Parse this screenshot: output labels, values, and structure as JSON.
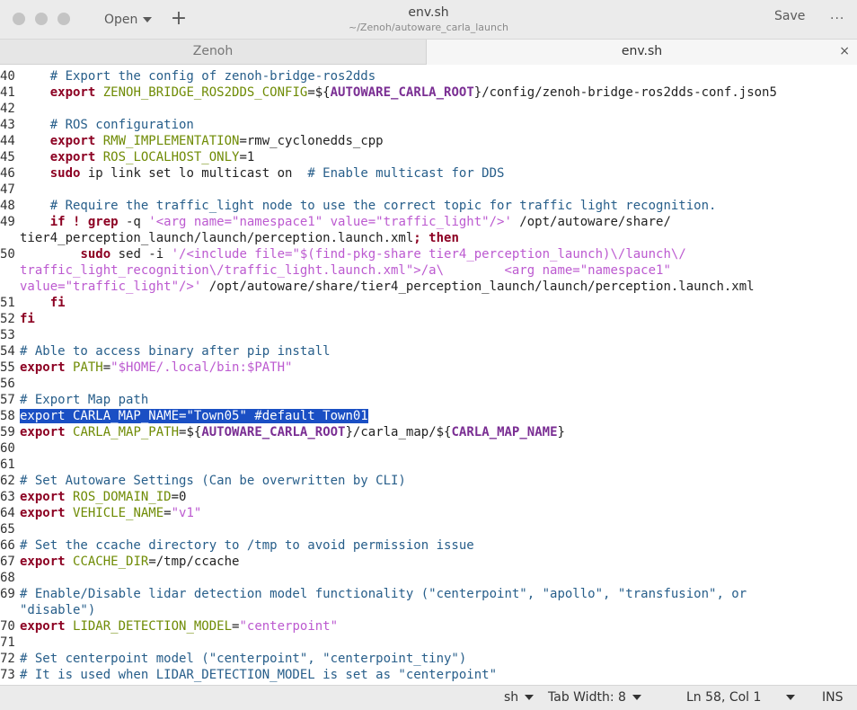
{
  "window": {
    "title": "env.sh",
    "subtitle": "~/Zenoh/autoware_carla_launch",
    "open_label": "Open",
    "new_tab_icon": "plus-icon",
    "save_label": "Save",
    "menu_icon": "ellipsis-icon"
  },
  "tabs": [
    {
      "label": "Zenoh",
      "active": false
    },
    {
      "label": "env.sh",
      "active": true,
      "close": "×"
    }
  ],
  "editor": {
    "current_line": "58",
    "lines": [
      {
        "n": "40",
        "segs": [
          [
            "w",
            "    "
          ],
          [
            "c",
            "# Export the config of zenoh-bridge-ros2dds"
          ]
        ]
      },
      {
        "n": "41",
        "segs": [
          [
            "w",
            "    "
          ],
          [
            "k",
            "export"
          ],
          [
            "w",
            " "
          ],
          [
            "v",
            "ZENOH_BRIDGE_ROS2DDS_CONFIG"
          ],
          [
            "w",
            "=${"
          ],
          [
            "hv",
            "AUTOWARE_CARLA_ROOT"
          ],
          [
            "w",
            "}/config/zenoh-bridge-ros2dds-conf.json5"
          ]
        ]
      },
      {
        "n": "42",
        "segs": []
      },
      {
        "n": "43",
        "segs": [
          [
            "w",
            "    "
          ],
          [
            "c",
            "# ROS configuration"
          ]
        ]
      },
      {
        "n": "44",
        "segs": [
          [
            "w",
            "    "
          ],
          [
            "k",
            "export"
          ],
          [
            "w",
            " "
          ],
          [
            "v",
            "RMW_IMPLEMENTATION"
          ],
          [
            "w",
            "=rmw_cyclonedds_cpp"
          ]
        ]
      },
      {
        "n": "45",
        "segs": [
          [
            "w",
            "    "
          ],
          [
            "k",
            "export"
          ],
          [
            "w",
            " "
          ],
          [
            "v",
            "ROS_LOCALHOST_ONLY"
          ],
          [
            "w",
            "=1"
          ]
        ]
      },
      {
        "n": "46",
        "segs": [
          [
            "w",
            "    "
          ],
          [
            "k",
            "sudo"
          ],
          [
            "w",
            " ip link set lo multicast on  "
          ],
          [
            "c",
            "# Enable multicast for DDS"
          ]
        ]
      },
      {
        "n": "47",
        "segs": []
      },
      {
        "n": "48",
        "segs": [
          [
            "w",
            "    "
          ],
          [
            "c",
            "# Require the traffic_light node to use the correct topic for traffic light recognition."
          ]
        ]
      },
      {
        "n": "49",
        "segs": [
          [
            "w",
            "    "
          ],
          [
            "k",
            "if ! grep"
          ],
          [
            "w",
            " -q "
          ],
          [
            "s",
            "'<arg name=\"namespace1\" value=\"traffic_light\"/>'"
          ],
          [
            "w",
            " /opt/autoware/share/"
          ]
        ]
      },
      {
        "n": "",
        "segs": [
          [
            "w",
            "tier4_perception_launch/launch/perception.launch.xml"
          ],
          [
            "k",
            "; then"
          ]
        ]
      },
      {
        "n": "50",
        "segs": [
          [
            "w",
            "        "
          ],
          [
            "k",
            "sudo"
          ],
          [
            "w",
            " sed -i "
          ],
          [
            "s",
            "'/<include file=\"$(find-pkg-share tier4_perception_launch)\\/launch\\/"
          ]
        ]
      },
      {
        "n": "",
        "segs": [
          [
            "s",
            "traffic_light_recognition\\/traffic_light.launch.xml\">/a\\        <arg name=\"namespace1\""
          ]
        ]
      },
      {
        "n": "",
        "segs": [
          [
            "s",
            "value=\"traffic_light\"/>'"
          ],
          [
            "w",
            " /opt/autoware/share/tier4_perception_launch/launch/perception.launch.xml"
          ]
        ]
      },
      {
        "n": "51",
        "segs": [
          [
            "w",
            "    "
          ],
          [
            "k",
            "fi"
          ]
        ]
      },
      {
        "n": "52",
        "segs": [
          [
            "k",
            "fi"
          ]
        ]
      },
      {
        "n": "53",
        "segs": []
      },
      {
        "n": "54",
        "segs": [
          [
            "c",
            "# Able to access binary after pip install"
          ]
        ]
      },
      {
        "n": "55",
        "segs": [
          [
            "k",
            "export"
          ],
          [
            "w",
            " "
          ],
          [
            "v",
            "PATH"
          ],
          [
            "w",
            "="
          ],
          [
            "s",
            "\"$HOME/.local/bin:$PATH\""
          ]
        ]
      },
      {
        "n": "56",
        "segs": []
      },
      {
        "n": "57",
        "segs": [
          [
            "c",
            "# Export Map path"
          ]
        ]
      },
      {
        "n": "58",
        "sel": true,
        "segs": [
          [
            "k",
            "export"
          ],
          [
            "w",
            " CARLA_MAP_NAME=\"Town05\" #default Town01"
          ]
        ]
      },
      {
        "n": "59",
        "segs": [
          [
            "k",
            "export"
          ],
          [
            "w",
            " "
          ],
          [
            "v",
            "CARLA_MAP_PATH"
          ],
          [
            "w",
            "=${"
          ],
          [
            "hv",
            "AUTOWARE_CARLA_ROOT"
          ],
          [
            "w",
            "}/carla_map/${"
          ],
          [
            "hv",
            "CARLA_MAP_NAME"
          ],
          [
            "w",
            "}"
          ]
        ]
      },
      {
        "n": "60",
        "segs": []
      },
      {
        "n": "61",
        "segs": []
      },
      {
        "n": "62",
        "segs": [
          [
            "c",
            "# Set Autoware Settings (Can be overwritten by CLI)"
          ]
        ]
      },
      {
        "n": "63",
        "segs": [
          [
            "k",
            "export"
          ],
          [
            "w",
            " "
          ],
          [
            "v",
            "ROS_DOMAIN_ID"
          ],
          [
            "w",
            "=0"
          ]
        ]
      },
      {
        "n": "64",
        "segs": [
          [
            "k",
            "export"
          ],
          [
            "w",
            " "
          ],
          [
            "v",
            "VEHICLE_NAME"
          ],
          [
            "w",
            "="
          ],
          [
            "s",
            "\"v1\""
          ]
        ]
      },
      {
        "n": "65",
        "segs": []
      },
      {
        "n": "66",
        "segs": [
          [
            "c",
            "# Set the ccache directory to /tmp to avoid permission issue"
          ]
        ]
      },
      {
        "n": "67",
        "segs": [
          [
            "k",
            "export"
          ],
          [
            "w",
            " "
          ],
          [
            "v",
            "CCACHE_DIR"
          ],
          [
            "w",
            "=/tmp/ccache"
          ]
        ]
      },
      {
        "n": "68",
        "segs": []
      },
      {
        "n": "69",
        "segs": [
          [
            "c",
            "# Enable/Disable lidar detection model functionality (\"centerpoint\", \"apollo\", \"transfusion\", or"
          ]
        ]
      },
      {
        "n": "",
        "segs": [
          [
            "c",
            "\"disable\")"
          ]
        ]
      },
      {
        "n": "70",
        "segs": [
          [
            "k",
            "export"
          ],
          [
            "w",
            " "
          ],
          [
            "v",
            "LIDAR_DETECTION_MODEL"
          ],
          [
            "w",
            "="
          ],
          [
            "s",
            "\"centerpoint\""
          ]
        ]
      },
      {
        "n": "71",
        "segs": []
      },
      {
        "n": "72",
        "segs": [
          [
            "c",
            "# Set centerpoint model (\"centerpoint\", \"centerpoint_tiny\")"
          ]
        ]
      },
      {
        "n": "73",
        "segs": [
          [
            "c",
            "# It is used when LIDAR_DETECTION_MODEL is set as \"centerpoint\""
          ]
        ]
      }
    ]
  },
  "status": {
    "language": "sh",
    "tab_width": "Tab Width: 8",
    "position": "Ln 58, Col 1",
    "mode": "INS"
  },
  "colors": {
    "keyword": "#8c0022",
    "variable": "#6f8b05",
    "string": "#bc5ad0",
    "comment": "#275e8a",
    "selection": "#1a4fc4"
  }
}
